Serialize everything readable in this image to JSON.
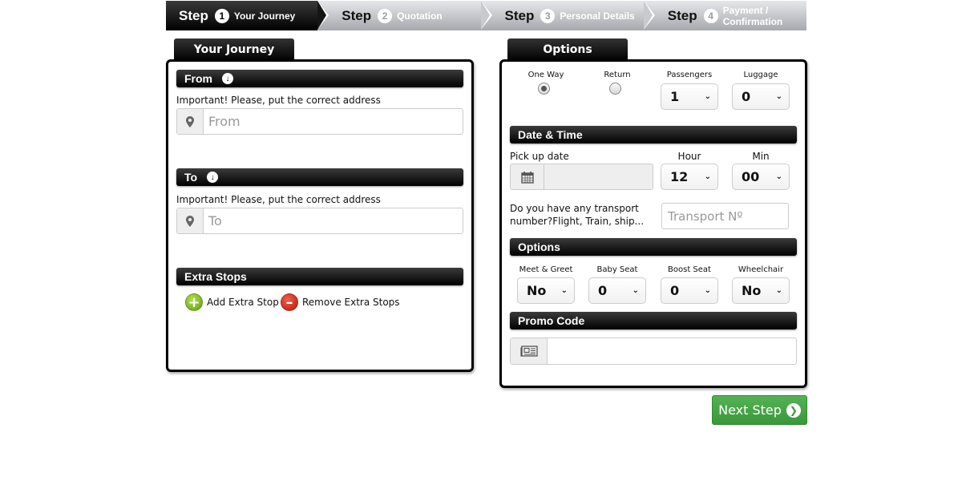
{
  "steps": [
    {
      "word": "Step",
      "number": "1",
      "label": "Your Journey",
      "active": true
    },
    {
      "word": "Step",
      "number": "2",
      "label": "Quotation",
      "active": false
    },
    {
      "word": "Step",
      "number": "3",
      "label": "Personal Details",
      "active": false
    },
    {
      "word": "Step",
      "number": "4",
      "label": "Payment / Confirmation",
      "active": false
    }
  ],
  "journey": {
    "tab_title": "Your Journey",
    "from": {
      "header": "From",
      "header_icon": "arrow-down-circle-icon",
      "note": "Important! Please, put the correct address",
      "icon": "map-marker-icon",
      "value": "",
      "placeholder": "From"
    },
    "to": {
      "header": "To",
      "header_icon": "arrow-down-circle-icon",
      "note": "Important! Please, put the correct address",
      "icon": "map-marker-icon",
      "value": "",
      "placeholder": "To"
    },
    "extra_stops": {
      "header": "Extra Stops",
      "add_label": "Add Extra Stop",
      "add_icon": "plus-circle-icon",
      "remove_label": "Remove Extra Stops",
      "remove_icon": "minus-circle-icon"
    }
  },
  "options": {
    "tab_title": "Options",
    "trip_type": {
      "one_way_label": "One Way",
      "return_label": "Return",
      "selected": "One Way"
    },
    "passengers": {
      "label": "Passengers",
      "value": "1"
    },
    "luggage": {
      "label": "Luggage",
      "value": "0"
    },
    "date_time": {
      "header": "Date & Time",
      "pickup_label": "Pick up date",
      "pickup_icon": "calendar-icon",
      "pickup_value": "",
      "hour_label": "Hour",
      "hour_value": "12",
      "min_label": "Min",
      "min_value": "00",
      "transport_question": "Do you have any transport number?Flight, Train, ship...",
      "transport_placeholder": "Transport Nº"
    },
    "extras": {
      "header": "Options",
      "meet_greet": {
        "label": "Meet & Greet",
        "value": "No"
      },
      "baby_seat": {
        "label": "Baby Seat",
        "value": "0"
      },
      "boost_seat": {
        "label": "Boost Seat",
        "value": "0"
      },
      "wheelchair": {
        "label": "Wheelchair",
        "value": "No"
      }
    },
    "promo": {
      "header": "Promo Code",
      "icon": "newspaper-icon",
      "value": ""
    }
  },
  "next_button": {
    "label": "Next Step",
    "icon": "chevron-right-circle-icon"
  },
  "colors": {
    "primary_dark": "#000000",
    "next_green": "#43a343",
    "step_inactive": "#a7a9ae"
  }
}
